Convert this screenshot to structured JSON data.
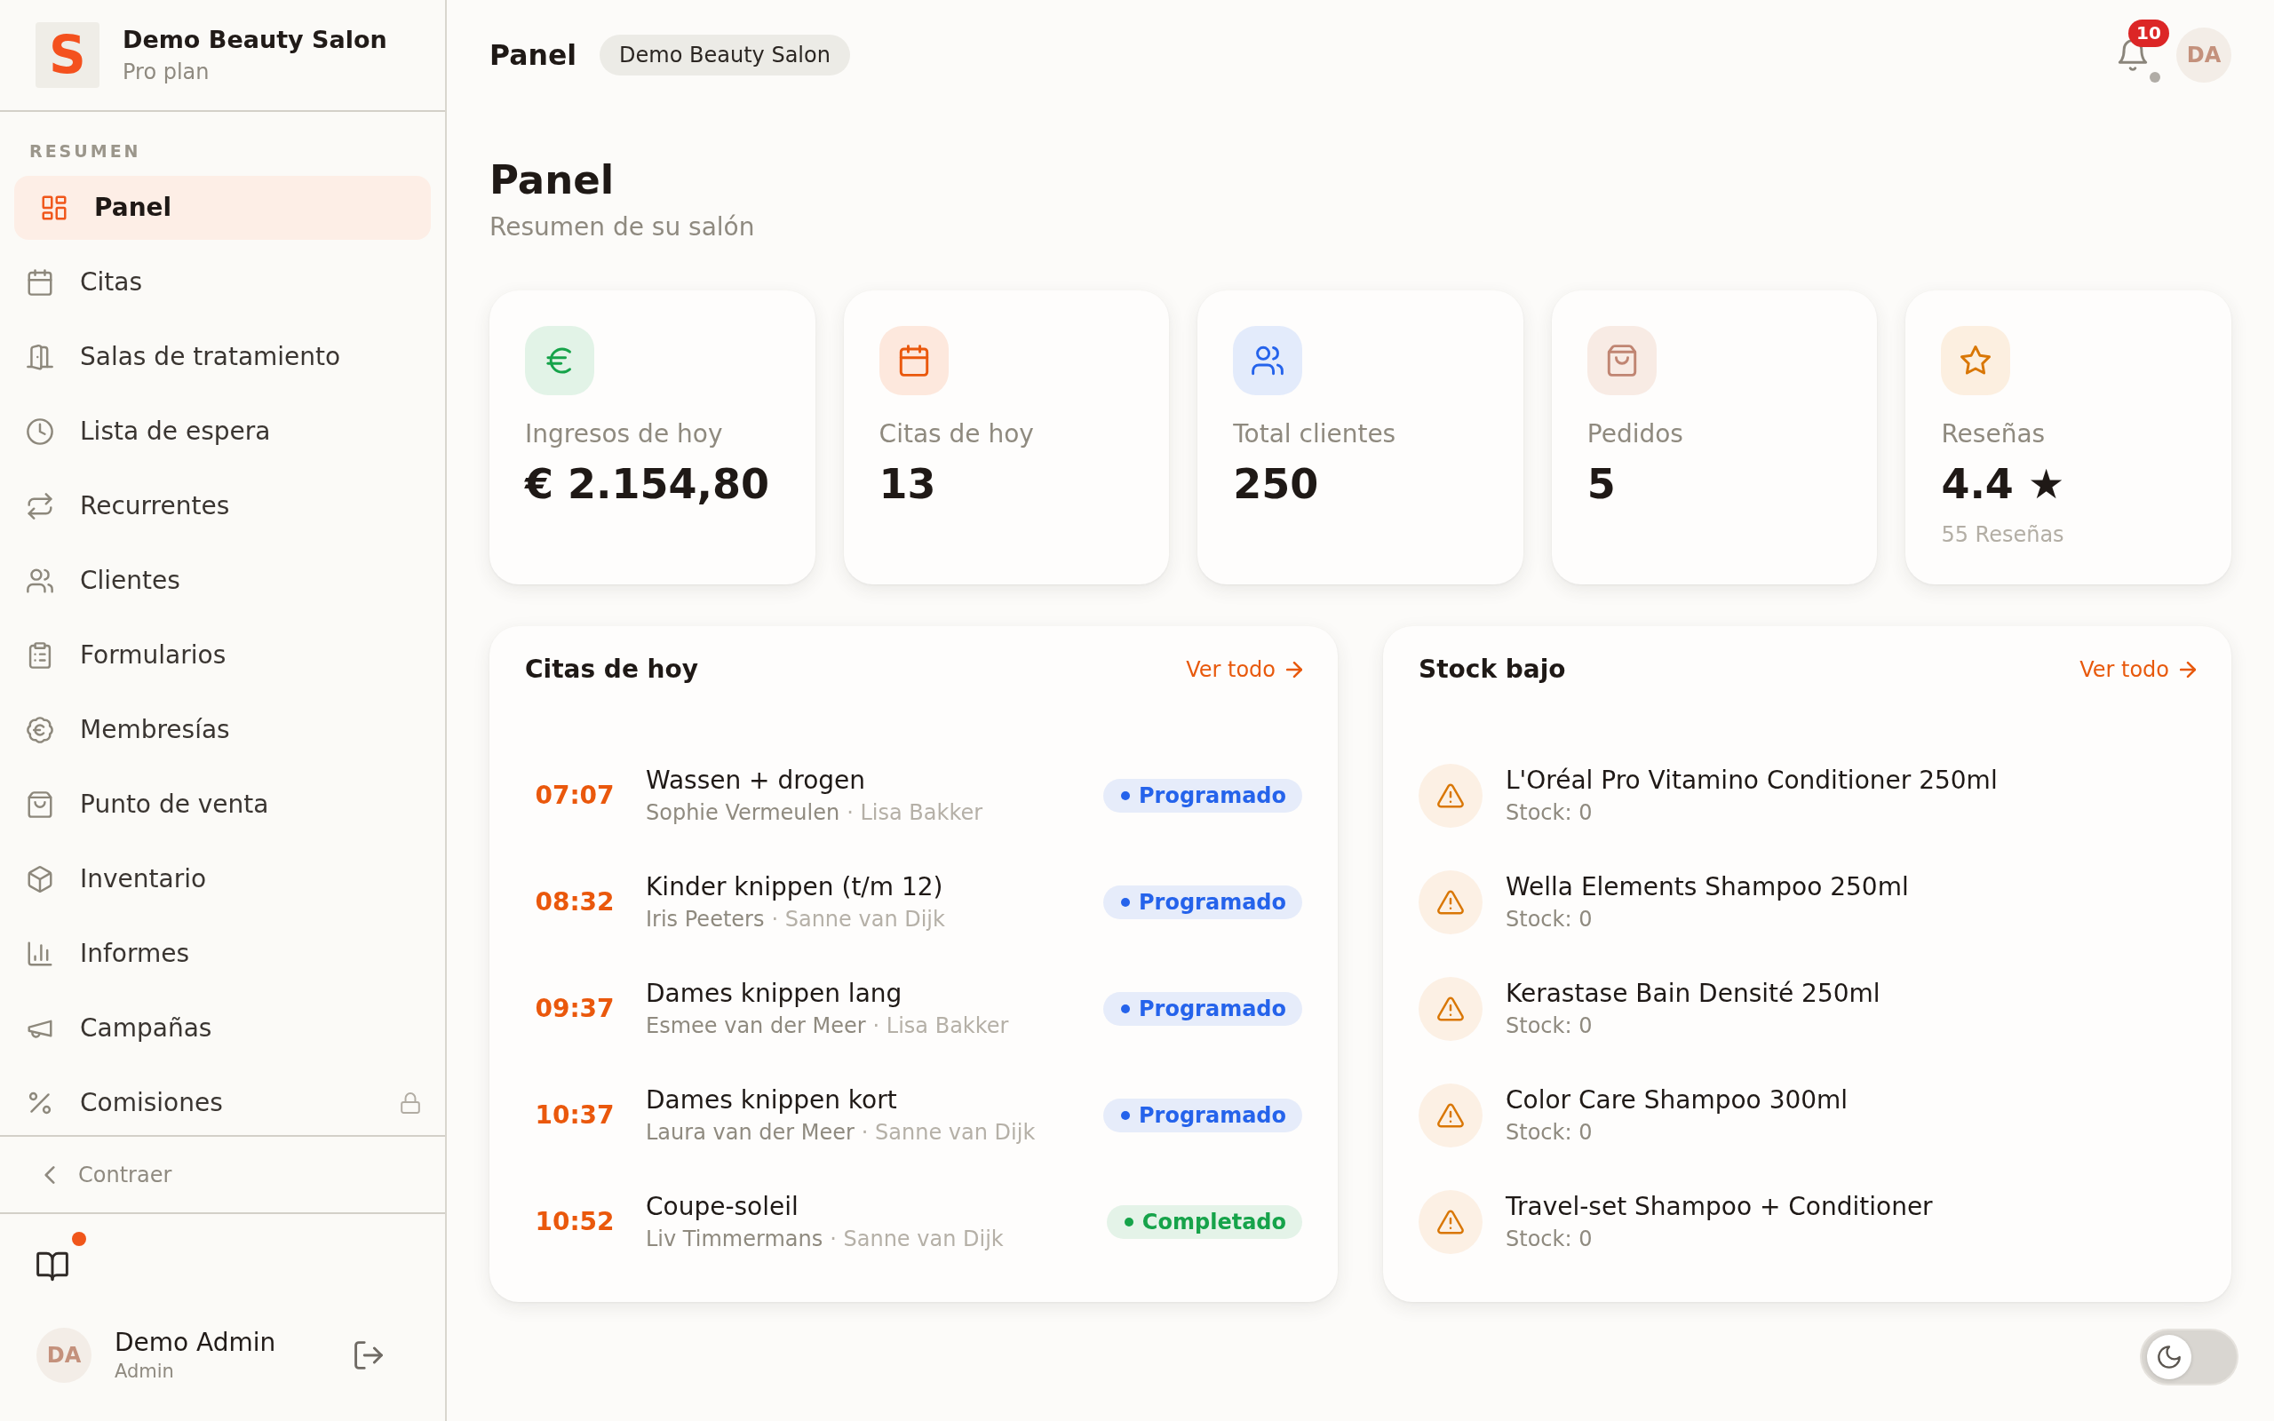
{
  "sidebar": {
    "brand": {
      "logo_letter": "S",
      "name": "Demo Beauty Salon",
      "plan": "Pro plan"
    },
    "section_label": "RESUMEN",
    "items": [
      {
        "label": "Panel",
        "selected": true,
        "locked": false
      },
      {
        "label": "Citas",
        "selected": false,
        "locked": false
      },
      {
        "label": "Salas de tratamiento",
        "selected": false,
        "locked": false
      },
      {
        "label": "Lista de espera",
        "selected": false,
        "locked": false
      },
      {
        "label": "Recurrentes",
        "selected": false,
        "locked": false
      },
      {
        "label": "Clientes",
        "selected": false,
        "locked": false
      },
      {
        "label": "Formularios",
        "selected": false,
        "locked": false
      },
      {
        "label": "Membresías",
        "selected": false,
        "locked": false
      },
      {
        "label": "Punto de venta",
        "selected": false,
        "locked": false
      },
      {
        "label": "Inventario",
        "selected": false,
        "locked": false
      },
      {
        "label": "Informes",
        "selected": false,
        "locked": false
      },
      {
        "label": "Campañas",
        "selected": false,
        "locked": false
      },
      {
        "label": "Comisiones",
        "selected": false,
        "locked": true
      }
    ],
    "collapse_label": "Contraer",
    "guide": {
      "unread": true
    },
    "user": {
      "initials": "DA",
      "name": "Demo Admin",
      "role": "Admin"
    }
  },
  "topbar": {
    "title": "Panel",
    "salon_badge": "Demo Beauty Salon",
    "notifications": {
      "count": "10"
    },
    "avatar_initials": "DA"
  },
  "page": {
    "title": "Panel",
    "subtitle": "Resumen de su salón"
  },
  "stats": [
    {
      "label": "Ingresos de hoy",
      "value": "€ 2.154,80"
    },
    {
      "label": "Citas de hoy",
      "value": "13"
    },
    {
      "label": "Total clientes",
      "value": "250"
    },
    {
      "label": "Pedidos",
      "value": "5"
    },
    {
      "label": "Reseñas",
      "value": "4.4 ★",
      "note": "55 Reseñas"
    }
  ],
  "appointments_panel": {
    "title": "Citas de hoy",
    "link": "Ver todo",
    "rows": [
      {
        "time": "07:07",
        "service": "Wassen + drogen",
        "client": "Sophie Vermeulen",
        "staff": "· Lisa Bakker",
        "status": {
          "label": "Programado",
          "color": "#2563eb"
        }
      },
      {
        "time": "08:32",
        "service": "Kinder knippen (t/m 12)",
        "client": "Iris Peeters",
        "staff": "· Sanne van Dijk",
        "status": {
          "label": "Programado",
          "color": "#2563eb"
        }
      },
      {
        "time": "09:37",
        "service": "Dames knippen lang",
        "client": "Esmee van der Meer",
        "staff": "· Lisa Bakker",
        "status": {
          "label": "Programado",
          "color": "#2563eb"
        }
      },
      {
        "time": "10:37",
        "service": "Dames knippen kort",
        "client": "Laura van der Meer",
        "staff": "· Sanne van Dijk",
        "status": {
          "label": "Programado",
          "color": "#2563eb"
        }
      },
      {
        "time": "10:52",
        "service": "Coupe-soleil",
        "client": "Liv Timmermans",
        "staff": "· Sanne van Dijk",
        "status": {
          "label": "Completado",
          "color": "#16a34a"
        }
      }
    ]
  },
  "low_stock_panel": {
    "title": "Stock bajo",
    "link": "Ver todo",
    "items": [
      {
        "name": "L'Oréal Pro Vitamino Conditioner 250ml",
        "stock": "Stock: 0"
      },
      {
        "name": "Wella Elements Shampoo 250ml",
        "stock": "Stock: 0"
      },
      {
        "name": "Kerastase Bain Densité 250ml",
        "stock": "Stock: 0"
      },
      {
        "name": "Color Care Shampoo 300ml",
        "stock": "Stock: 0"
      },
      {
        "name": "Travel-set Shampoo + Conditioner",
        "stock": "Stock: 0"
      }
    ]
  },
  "theme_toggle": {
    "on": false
  }
}
